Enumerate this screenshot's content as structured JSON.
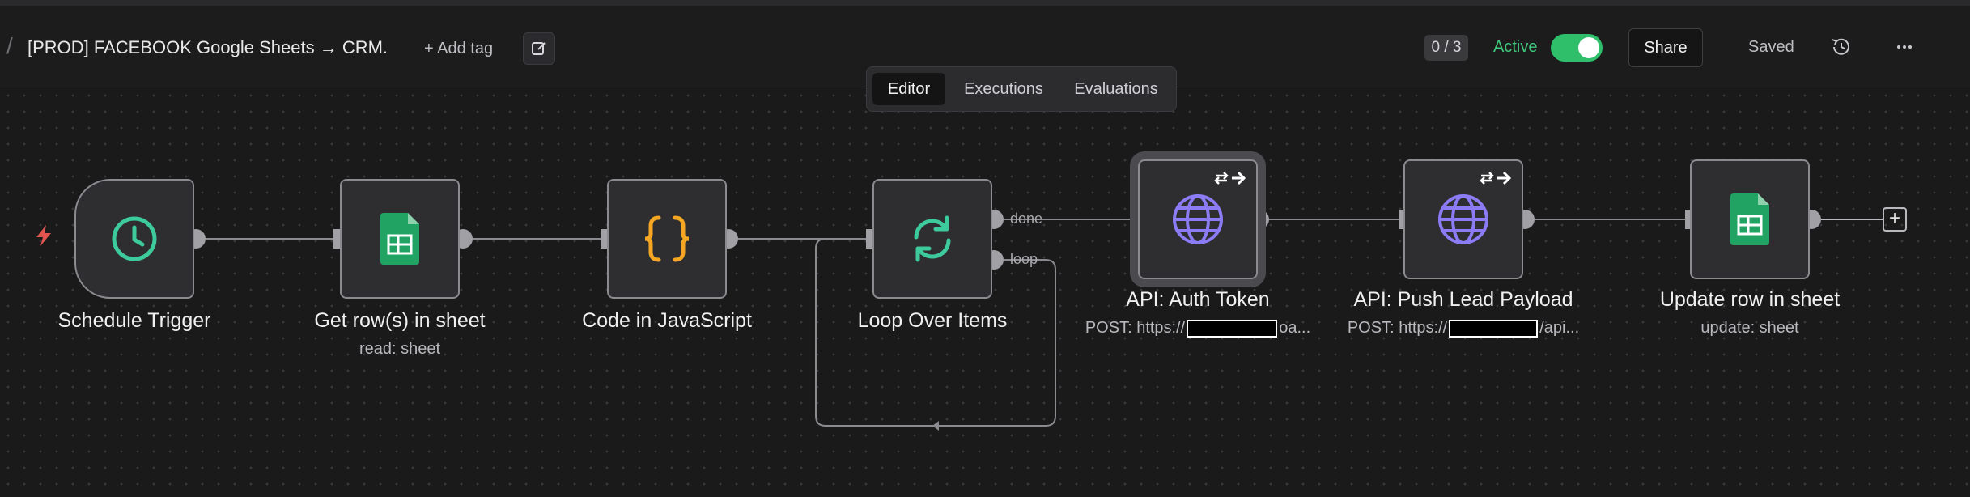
{
  "header": {
    "workflow_title": "[PROD]  FACEBOOK Google Sheets → CRM.",
    "add_tag_label": "+ Add tag",
    "counter": "0 / 3",
    "active_label": "Active",
    "share_label": "Share",
    "saved_label": "Saved"
  },
  "tabs": [
    {
      "label": "Editor",
      "selected": true
    },
    {
      "label": "Executions",
      "selected": false
    },
    {
      "label": "Evaluations",
      "selected": false
    }
  ],
  "nodes": [
    {
      "title": "Schedule Trigger",
      "subtitle": "",
      "icon": "clock-icon"
    },
    {
      "title": "Get row(s) in sheet",
      "subtitle": "read: sheet",
      "icon": "google-sheets-icon"
    },
    {
      "title": "Code in JavaScript",
      "subtitle": "",
      "icon": "code-braces-icon"
    },
    {
      "title": "Loop Over Items",
      "subtitle": "",
      "icon": "loop-icon"
    },
    {
      "title": "API: Auth Token",
      "subtitle_prefix": "POST: https://",
      "subtitle_suffix": "oa...",
      "icon": "globe-icon"
    },
    {
      "title": "API: Push Lead Payload",
      "subtitle_prefix": "POST: https://",
      "subtitle_suffix": "/api...",
      "icon": "globe-icon"
    },
    {
      "title": "Update row in sheet",
      "subtitle": "update: sheet",
      "icon": "google-sheets-icon"
    }
  ],
  "ports": {
    "done_label": "done",
    "loop_label": "loop"
  },
  "colors": {
    "active_green": "#3ec67a",
    "globe_purple": "#8b7cf6",
    "sheets_green": "#21a463",
    "code_orange": "#f5a623",
    "trigger_teal": "#3ecb9c",
    "bolt_red": "#e2554f"
  }
}
